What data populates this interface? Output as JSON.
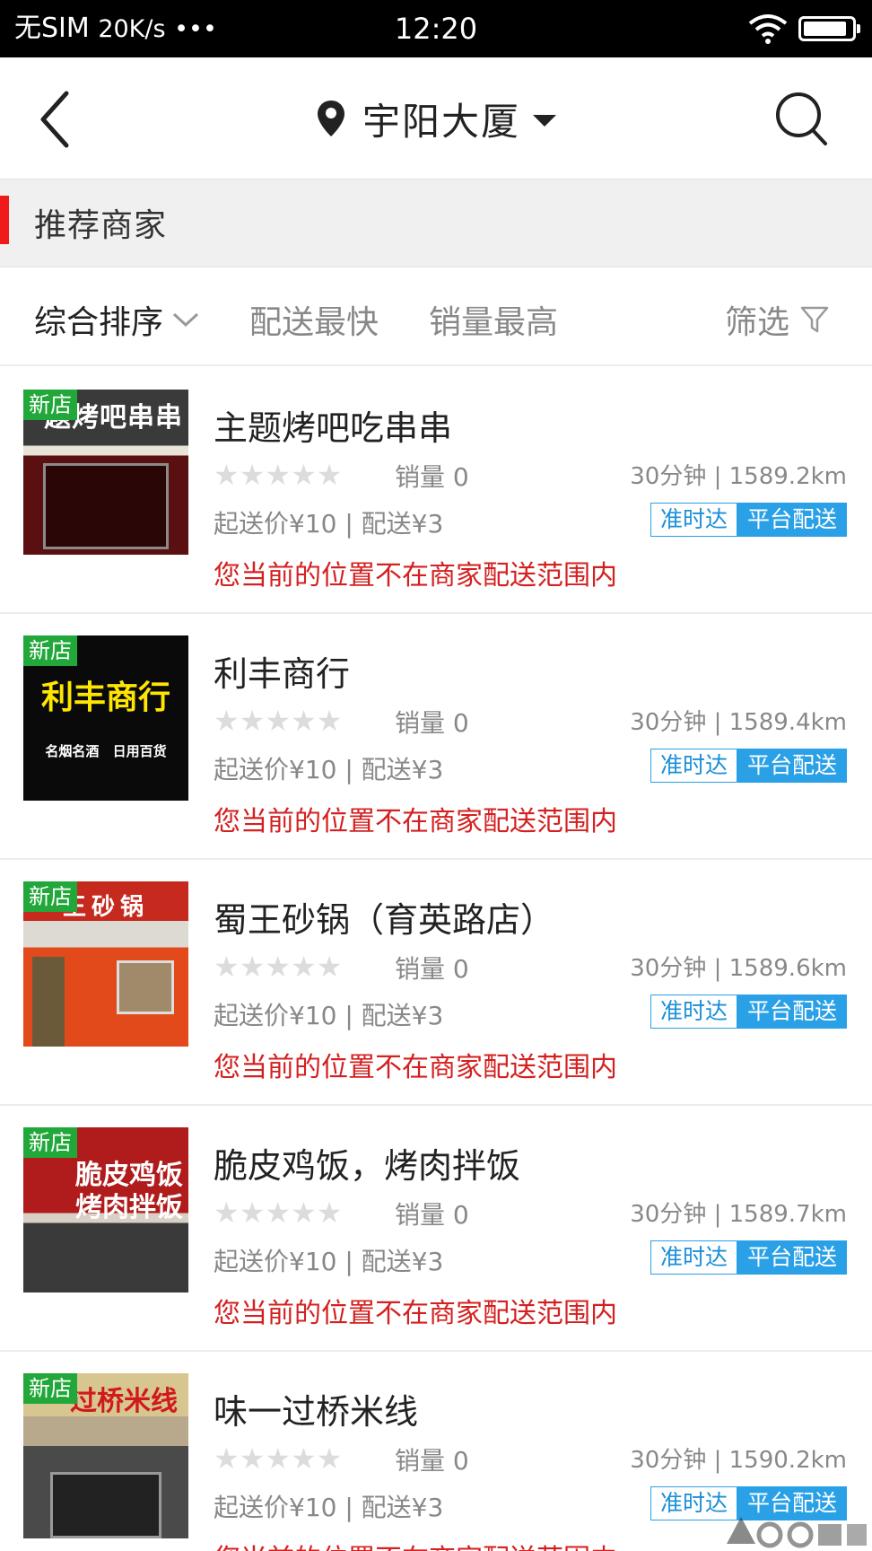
{
  "status_bar": {
    "carrier": "无SIM",
    "speed": "20K/s",
    "dots": "•••",
    "time": "12:20",
    "battery_level": 0.92
  },
  "header": {
    "location": "宇阳大厦",
    "back_icon": "chevron-left-icon",
    "search_icon": "search-icon",
    "pin_icon": "location-pin-icon"
  },
  "section": {
    "title": "推荐商家",
    "accent_color": "#f01a1a"
  },
  "sort": {
    "items": [
      "综合排序",
      "配送最快",
      "销量最高"
    ],
    "filter": "筛选"
  },
  "colors": {
    "new_badge": "#22a83a",
    "warning": "#d42020",
    "tag_blue": "#2aa0e6"
  },
  "shops": [
    {
      "badge": "新店",
      "name": "主题烤吧吃串串",
      "stars": "★★★★★",
      "rating": 0,
      "sales": "销量 0",
      "distance": "30分钟 | 1589.2km",
      "fees": "起送价¥10 | 配送¥3",
      "tag1": "准时达",
      "tag2": "平台配送",
      "warning": "您当前的位置不在商家配送范围内",
      "thumb_sign": "题烤吧串串"
    },
    {
      "badge": "新店",
      "name": "利丰商行",
      "stars": "★★★★★",
      "rating": 0,
      "sales": "销量 0",
      "distance": "30分钟 | 1589.4km",
      "fees": "起送价¥10 | 配送¥3",
      "tag1": "准时达",
      "tag2": "平台配送",
      "warning": "您当前的位置不在商家配送范围内",
      "thumb_sign": "利丰商行",
      "thumb_sub": "名烟名酒 日用百货"
    },
    {
      "badge": "新店",
      "name": "蜀王砂锅（育英路店）",
      "stars": "★★★★★",
      "rating": 0,
      "sales": "销量 0",
      "distance": "30分钟 | 1589.6km",
      "fees": "起送价¥10 | 配送¥3",
      "tag1": "准时达",
      "tag2": "平台配送",
      "warning": "您当前的位置不在商家配送范围内",
      "thumb_sign": "王砂锅"
    },
    {
      "badge": "新店",
      "name": "脆皮鸡饭，烤肉拌饭",
      "stars": "★★★★★",
      "rating": 0,
      "sales": "销量 0",
      "distance": "30分钟 | 1589.7km",
      "fees": "起送价¥10 | 配送¥3",
      "tag1": "准时达",
      "tag2": "平台配送",
      "warning": "您当前的位置不在商家配送范围内",
      "thumb_sign": "脆皮鸡饭",
      "thumb_sign2": "烤肉拌饭"
    },
    {
      "badge": "新店",
      "name": "味一过桥米线",
      "stars": "★★★★★",
      "rating": 0,
      "sales": "销量 0",
      "distance": "30分钟 | 1590.2km",
      "fees": "起送价¥10 | 配送¥3",
      "tag1": "准时达",
      "tag2": "平台配送",
      "warning": "您当前的位置不在商家配送范围内",
      "thumb_sign": "过桥米线"
    }
  ]
}
